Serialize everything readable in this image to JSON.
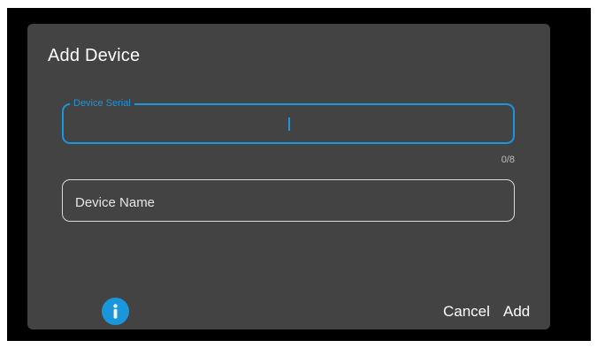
{
  "dialog": {
    "title": "Add Device",
    "serial_field": {
      "label": "Device Serial",
      "value": "",
      "counter": "0/8"
    },
    "name_field": {
      "placeholder": "Device Name",
      "value": ""
    },
    "info_icon": "info-icon",
    "actions": {
      "cancel_label": "Cancel",
      "add_label": "Add"
    }
  },
  "colors": {
    "accent": "#1a96dc",
    "dialog_bg": "#434343",
    "backdrop": "#000000"
  }
}
